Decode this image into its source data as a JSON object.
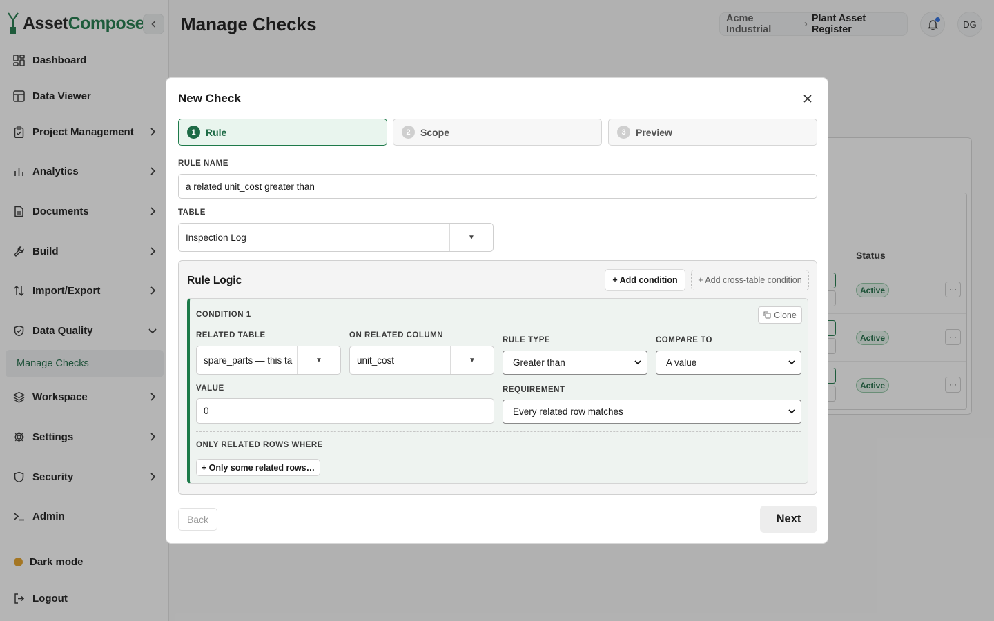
{
  "app": {
    "name_part1": "Asset",
    "name_part2": "Compose"
  },
  "sidebar": {
    "items": [
      {
        "label": "Dashboard",
        "icon": "dashboard-icon"
      },
      {
        "label": "Data Viewer",
        "icon": "table-icon"
      },
      {
        "label": "Project Management",
        "icon": "clipboard-icon"
      },
      {
        "label": "Analytics",
        "icon": "bar-chart-icon"
      },
      {
        "label": "Documents",
        "icon": "document-icon"
      },
      {
        "label": "Build",
        "icon": "wrench-icon"
      },
      {
        "label": "Import/Export",
        "icon": "import-export-icon"
      },
      {
        "label": "Data Quality",
        "icon": "shield-check-icon"
      },
      {
        "label": "Workspace",
        "icon": "layers-icon"
      },
      {
        "label": "Settings",
        "icon": "gear-icon"
      },
      {
        "label": "Security",
        "icon": "shield-icon"
      },
      {
        "label": "Admin",
        "icon": "terminal-icon"
      }
    ],
    "subitem": "Manage Checks",
    "dark_mode": "Dark mode",
    "logout": "Logout"
  },
  "header": {
    "title": "Manage Checks",
    "breadcrumb": [
      "Acme Industrial",
      "Plant Asset Register"
    ],
    "avatar_initials": "DG"
  },
  "background_table": {
    "status_header": "Status",
    "rows": [
      {
        "status": "Active"
      },
      {
        "status": "Active"
      },
      {
        "status": "Active"
      }
    ],
    "more_label": "···"
  },
  "modal": {
    "title": "New Check",
    "steps": [
      {
        "num": "1",
        "label": "Rule",
        "active": true
      },
      {
        "num": "2",
        "label": "Scope",
        "active": false
      },
      {
        "num": "3",
        "label": "Preview",
        "active": false
      }
    ],
    "rule_name_label": "RULE NAME",
    "rule_name_value": "a related unit_cost greater than",
    "table_label": "TABLE",
    "table_value": "Inspection Log",
    "rule_logic": {
      "title": "Rule Logic",
      "add_condition": "+ Add condition",
      "add_cross_table": "+ Add cross-table condition",
      "condition": {
        "title": "CONDITION 1",
        "clone": "Clone",
        "related_table_label": "RELATED TABLE",
        "related_table_value": "spare_parts — this ta",
        "related_column_label": "ON RELATED COLUMN",
        "related_column_value": "unit_cost",
        "rule_type_label": "RULE TYPE",
        "rule_type_value": "Greater than",
        "compare_to_label": "COMPARE TO",
        "compare_to_value": "A value",
        "value_label": "VALUE",
        "value_value": "0",
        "requirement_label": "REQUIREMENT",
        "requirement_value": "Every related row matches",
        "only_rows_label": "ONLY RELATED ROWS WHERE",
        "only_rows_button": "+ Only some related rows…"
      }
    },
    "back": "Back",
    "next": "Next"
  },
  "colors": {
    "brand": "#1e7a4a",
    "brand_dark": "#1e6b46",
    "dark_mode_dot": "#e6a126",
    "notify_dot": "#2e6fe0"
  }
}
